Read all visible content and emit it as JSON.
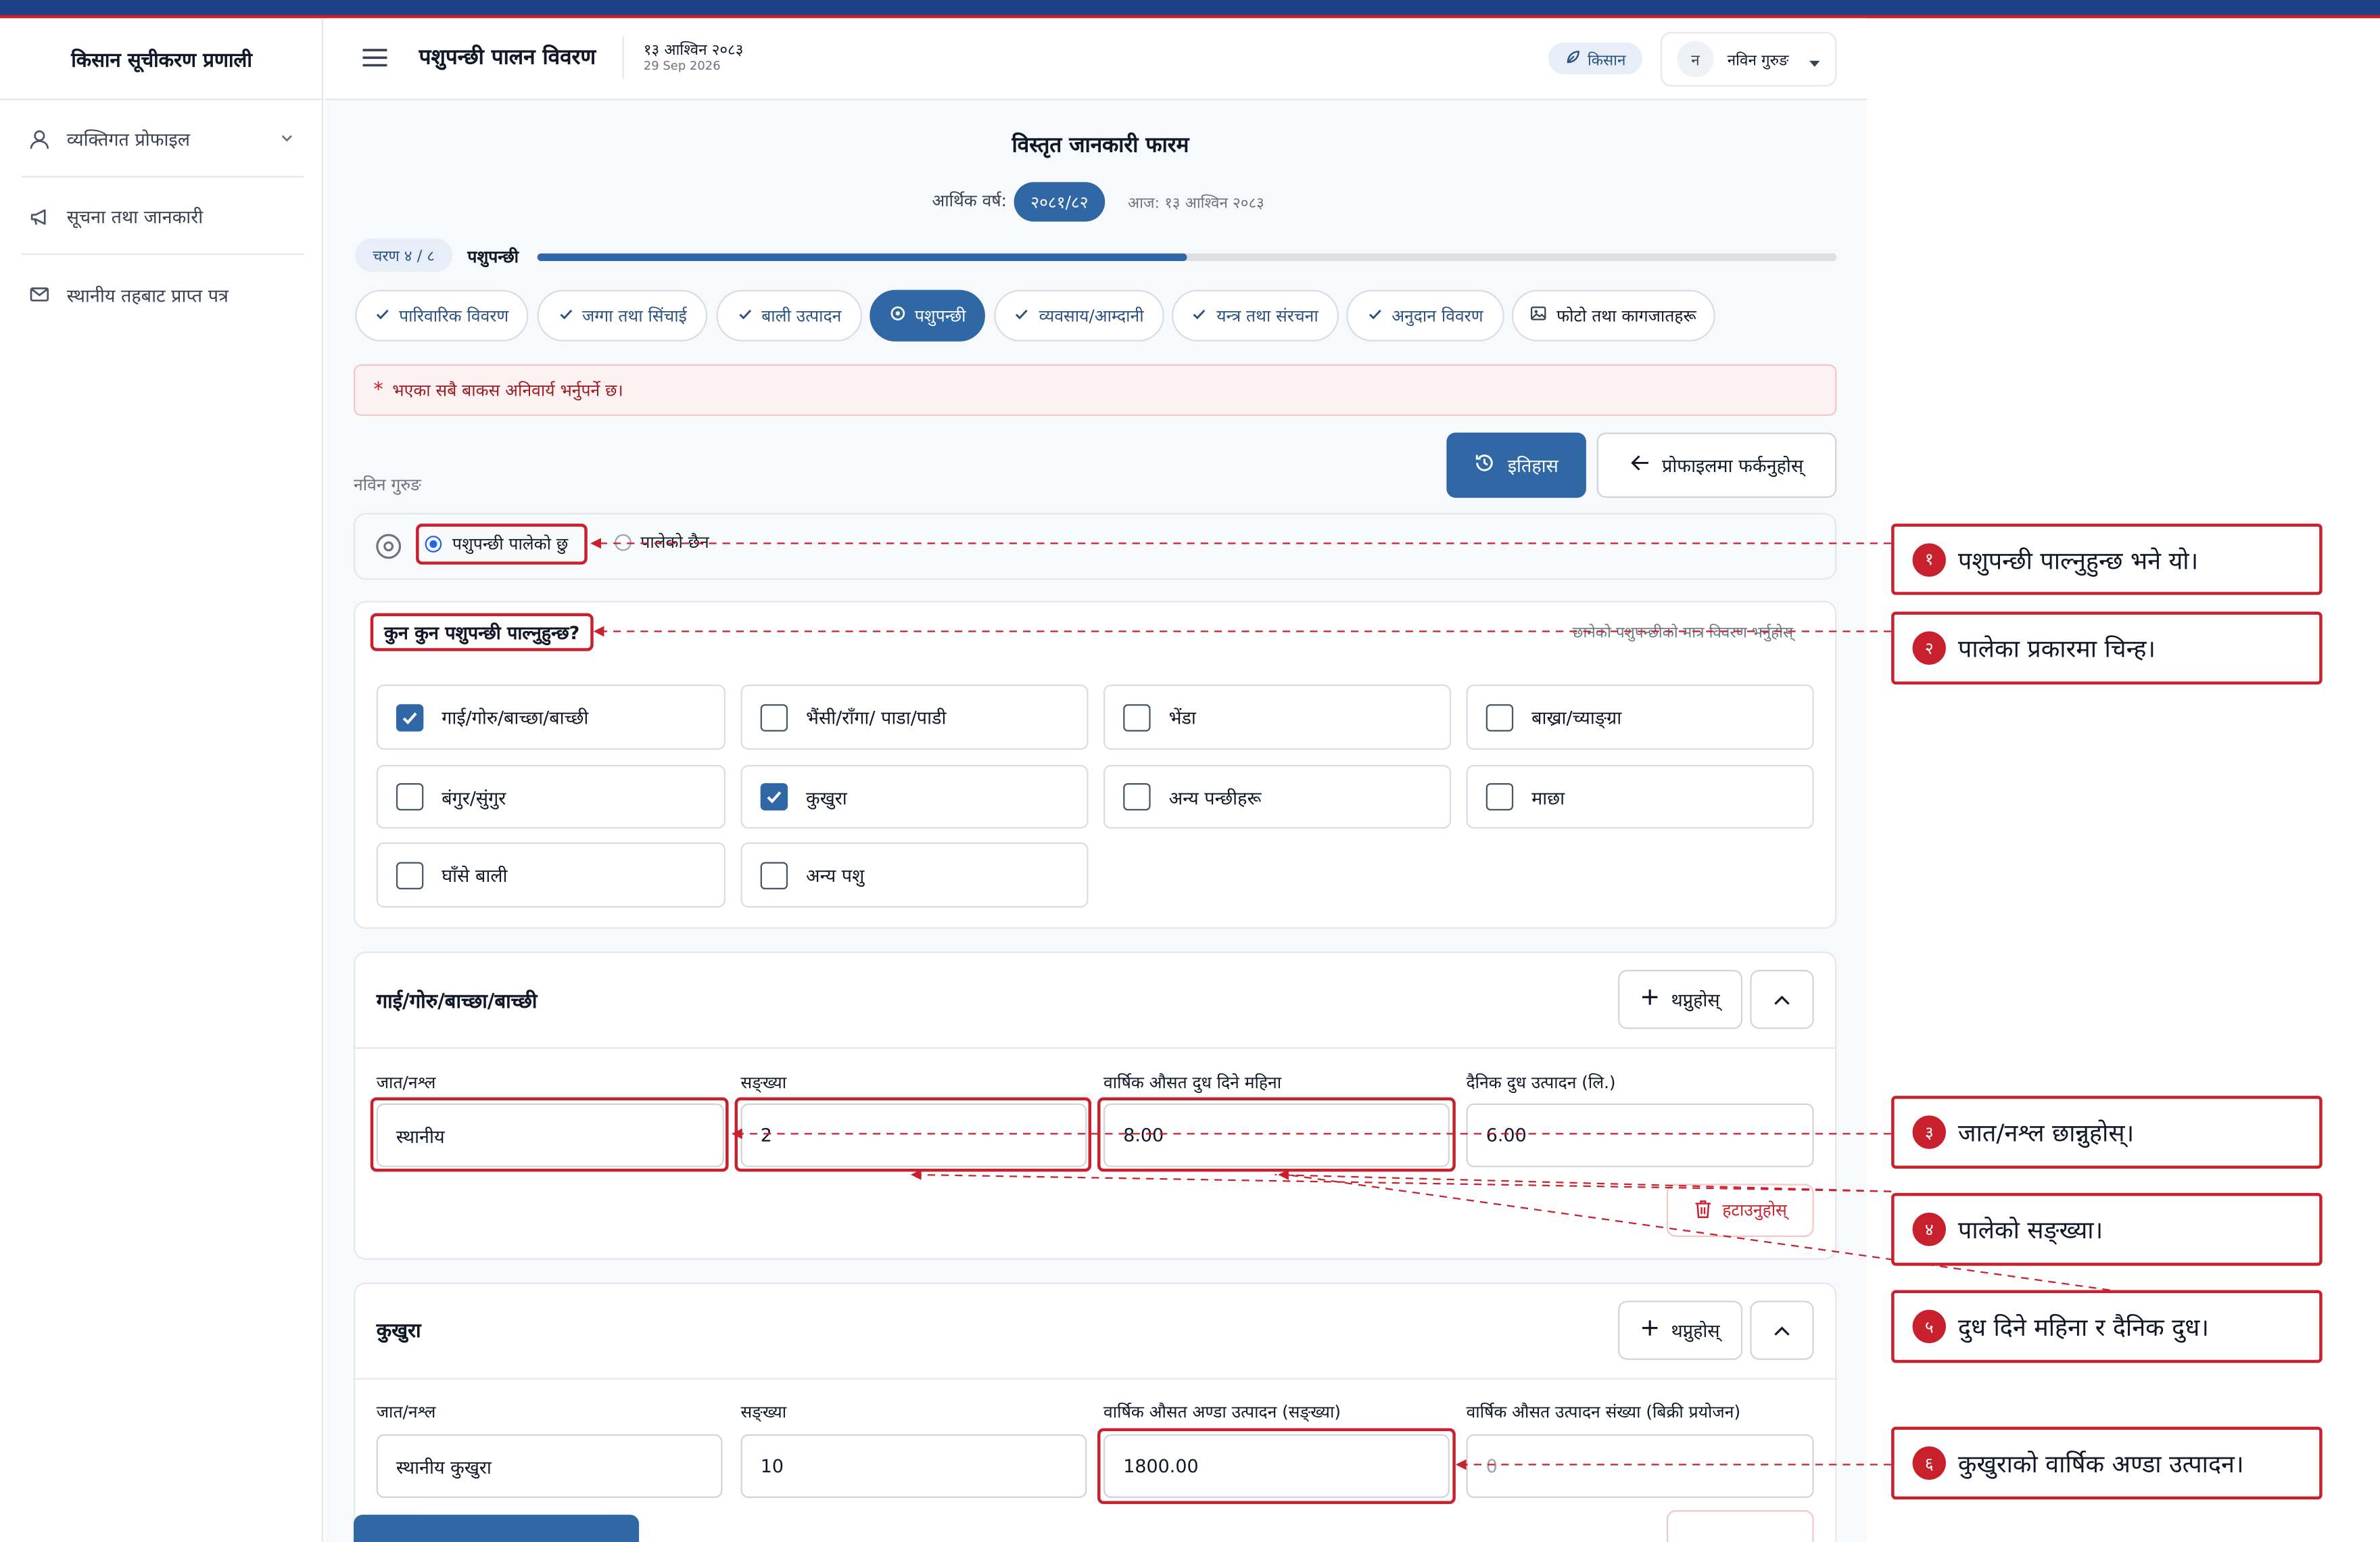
{
  "sidebar": {
    "title": "किसान सूचीकरण प्रणाली",
    "items": [
      {
        "label": "व्यक्तिगत प्रोफाइल",
        "icon": "user-icon"
      },
      {
        "label": "सूचना तथा जानकारी",
        "icon": "megaphone-icon"
      },
      {
        "label": "स्थानीय तहबाट प्राप्त पत्र",
        "icon": "mail-icon"
      }
    ]
  },
  "header": {
    "title": "पशुपन्छी पालन विवरण",
    "date_bs": "१३ आश्विन २०८३",
    "date_ad": "29 Sep 2026",
    "role_badge": "किसान",
    "user_initial": "न",
    "user_name": "नविन गुरुङ"
  },
  "form": {
    "title": "विस्तृत जानकारी फारम",
    "fiscal_year_label": "आर्थिक वर्ष:",
    "fiscal_year": "२०८१/८२",
    "today_label": "आज: १३ आश्विन २०८३",
    "step_label": "चरण ४ / ८",
    "step_name": "पशुपन्छी",
    "progress": 0.5,
    "tabs": [
      {
        "label": "पारिवारिक विवरण",
        "done": true
      },
      {
        "label": "जग्गा तथा सिंचाई",
        "done": true
      },
      {
        "label": "बाली उत्पादन",
        "done": true
      },
      {
        "label": "पशुपन्छी",
        "active": true
      },
      {
        "label": "व्यवसाय/आम्दानी",
        "done": true
      },
      {
        "label": "यन्त्र तथा संरचना",
        "done": true
      },
      {
        "label": "अनुदान विवरण",
        "done": true
      },
      {
        "label": "फोटो तथा कागजातहरू",
        "done": false
      }
    ],
    "required_note": "भएका सबै बाकस अनिवार्य भर्नुपर्ने छ।",
    "required_star": "*",
    "history_button": "इतिहास",
    "back_button": "प्रोफाइलमा फर्कनुहोस्",
    "farmer_name": "नविन गुरुङ",
    "raised_yes": "पशुपन्छी पालेको छु",
    "raised_no": "पालेको छैन",
    "which_question": "कुन कुन पशुपन्छी पाल्नुहुन्छ?",
    "which_hint": "छानेको पशुपन्छीको मात्र विवरण भर्नुहोस्",
    "animals": [
      {
        "label": "गाई/गोरु/बाच्छा/बाच्छी",
        "checked": true
      },
      {
        "label": "भैंसी/राँगा/ पाडा/पाडी",
        "checked": false
      },
      {
        "label": "भेंडा",
        "checked": false
      },
      {
        "label": "बाख्रा/च्याङ्ग्रा",
        "checked": false
      },
      {
        "label": "बंगुर/सुंगुर",
        "checked": false
      },
      {
        "label": "कुखुरा",
        "checked": true
      },
      {
        "label": "अन्य पन्छीहरू",
        "checked": false
      },
      {
        "label": "माछा",
        "checked": false
      },
      {
        "label": "घाँसे बाली",
        "checked": false
      },
      {
        "label": "अन्य पशु",
        "checked": false
      }
    ],
    "cattle_section": {
      "title": "गाई/गोरु/बाच्छा/बाच्छी",
      "add_button": "थप्नुहोस्",
      "remove_button": "हटाउनुहोस्",
      "labels": [
        "जात/नश्ल",
        "सङ्ख्या",
        "वार्षिक औसत दुध दिने महिना",
        "दैनिक दुध उत्पादन (लि.)"
      ],
      "values": [
        "स्थानीय",
        "2",
        "8.00",
        "6.00"
      ]
    },
    "poultry_section": {
      "title": "कुखुरा",
      "add_button": "थप्नुहोस्",
      "labels": [
        "जात/नश्ल",
        "सङ्ख्या",
        "वार्षिक औसत अण्डा उत्पादन (सङ्ख्या)",
        "वार्षिक औसत उत्पादन संख्या (बिक्री प्रयोजन)"
      ],
      "values": [
        "स्थानीय कुखुरा",
        "10",
        "1800.00",
        "0"
      ]
    }
  },
  "callouts": [
    {
      "num": "१",
      "text": "पशुपन्छी पाल्नुहुन्छ भने यो।"
    },
    {
      "num": "२",
      "text": "पालेका प्रकारमा चिन्ह।"
    },
    {
      "num": "३",
      "text": "जात/नश्ल छान्नुहोस्।"
    },
    {
      "num": "४",
      "text": "पालेको सङ्ख्या।"
    },
    {
      "num": "५",
      "text": "दुध दिने महिना र दैनिक दुध।"
    },
    {
      "num": "६",
      "text": "कुखुराको वार्षिक अण्डा उत्पादन।"
    }
  ],
  "colors": {
    "primary": "#2f68a5",
    "accent_red": "#c8202c",
    "nav_blue": "#1f3f86"
  }
}
